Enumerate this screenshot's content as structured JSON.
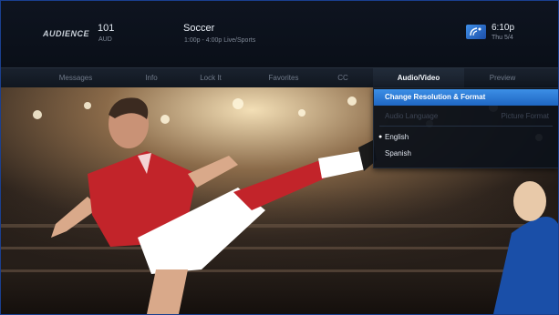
{
  "header": {
    "logo": "AUDIENCE",
    "channel_number": "101",
    "channel_sub": "AUD",
    "program_title": "Soccer",
    "program_sub": "1:00p - 4:00p Live/Sports",
    "time": "6:10p",
    "day": "Thu 5/4"
  },
  "menu": {
    "items": [
      {
        "label": "Messages"
      },
      {
        "label": "Info"
      },
      {
        "label": "Lock It"
      },
      {
        "label": "Favorites"
      },
      {
        "label": "CC"
      },
      {
        "label": "Audio/Video"
      },
      {
        "label": "Preview"
      }
    ],
    "active_index": 5
  },
  "dropdown": {
    "selected_label": "Change Resolution & Format",
    "disabled_left": "Audio Language",
    "disabled_right": "Picture Format",
    "options": [
      {
        "label": "English",
        "checked": true
      },
      {
        "label": "Spanish",
        "checked": false
      }
    ]
  },
  "icons": {
    "satellite": "satellite-dish-icon",
    "bullet": "bullet-icon"
  },
  "colors": {
    "accent": "#2f7fde",
    "frame_border": "#1a3f8f",
    "active_menu_text": "#f4f7fb",
    "inactive_menu_text": "#6f7989"
  }
}
